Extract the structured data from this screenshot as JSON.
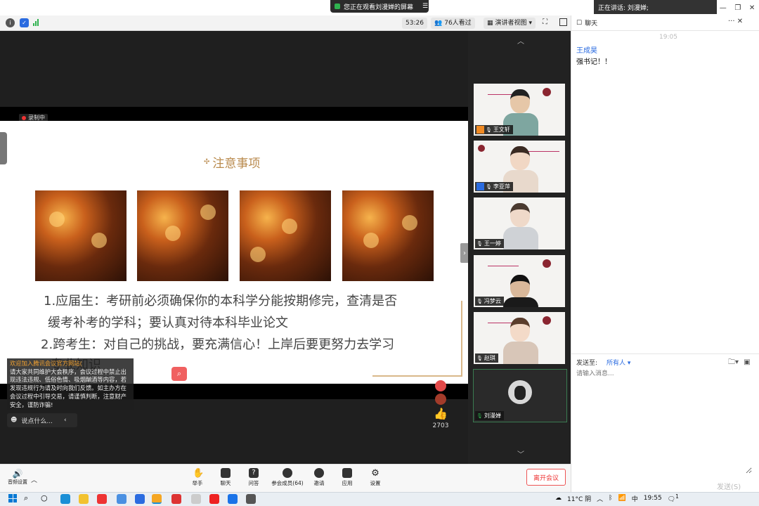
{
  "titlebar": {
    "sharing_text": "您正在观看刘漫婵的屏幕",
    "speaking_text": "正在讲话: 刘漫婵;",
    "min": "—",
    "restore": "❐",
    "close": "✕"
  },
  "toolbar": {
    "timer": "53:26",
    "viewers": "76人看过",
    "view_mode": "演讲者视图"
  },
  "stage": {
    "recording": "录制中",
    "slide_title": "注意事项",
    "line1": "1.应届生：考研前必须确保你的本科学分能按期修完，查清是否",
    "line2": "缓考补考的学科；要认真对待本科毕业论文",
    "line3": "2.跨考生：对自己的挑战，要充满信心！上岸后要更努力去学习",
    "line4": "专业知识",
    "notice_head": "欢迎加入腾讯会议",
    "notice_head2": "官方网站(",
    "notice_body": "请大家共同维护大会秩序，会议过程中禁止出现违法违规、低俗色情、吸烟酗酒等内容，若发现违规行为请及时向我们反馈。如主办方在会议过程中引导交易，请谨慎判断，注意财产安全，谨防诈骗!",
    "say_placeholder": "说点什么...",
    "like_count": "2703"
  },
  "participants": [
    {
      "name": "王文轩",
      "role": "host",
      "bodyColor": "#7ea6a0",
      "headColor": "#e6c7a8",
      "hairColor": "#222"
    },
    {
      "name": "李亚萍",
      "role": "cohost",
      "bodyColor": "#e8d9cc",
      "headColor": "#f1d7c4",
      "hairColor": "#3a2a22"
    },
    {
      "name": "王一婷",
      "role": "none",
      "bodyColor": "#cfd2d6",
      "headColor": "#efd9c9",
      "hairColor": "#4a3a30"
    },
    {
      "name": "冯梦云",
      "role": "none",
      "bodyColor": "#1a1a1a",
      "headColor": "#d9b89a",
      "hairColor": "#111"
    },
    {
      "name": "赵琪",
      "role": "none",
      "bodyColor": "#d8c6b8",
      "headColor": "#f3dac8",
      "hairColor": "#5a3d2c"
    },
    {
      "name": "刘漫婵",
      "role": "self"
    }
  ],
  "chat": {
    "title": "聊天",
    "time": "19:05",
    "sender": "王成昊",
    "message": "强书记！！",
    "send_to_label": "发送至:",
    "send_target": "所有人",
    "input_placeholder": "请输入消息...",
    "send_button": "发送(S)"
  },
  "bottombar": {
    "audio": "音频设置",
    "tools": [
      "举手",
      "聊天",
      "问答",
      "参会成员(64)",
      "邀请",
      "应用",
      "设置"
    ],
    "leave": "离开会议"
  },
  "taskbar": {
    "weather": "11°C 阴",
    "ime": "中",
    "time": "19:55",
    "notif": "1"
  },
  "colors": {
    "accent": "#2a6be0",
    "title_gold": "#b98a4d",
    "leave_red": "#e33333"
  }
}
